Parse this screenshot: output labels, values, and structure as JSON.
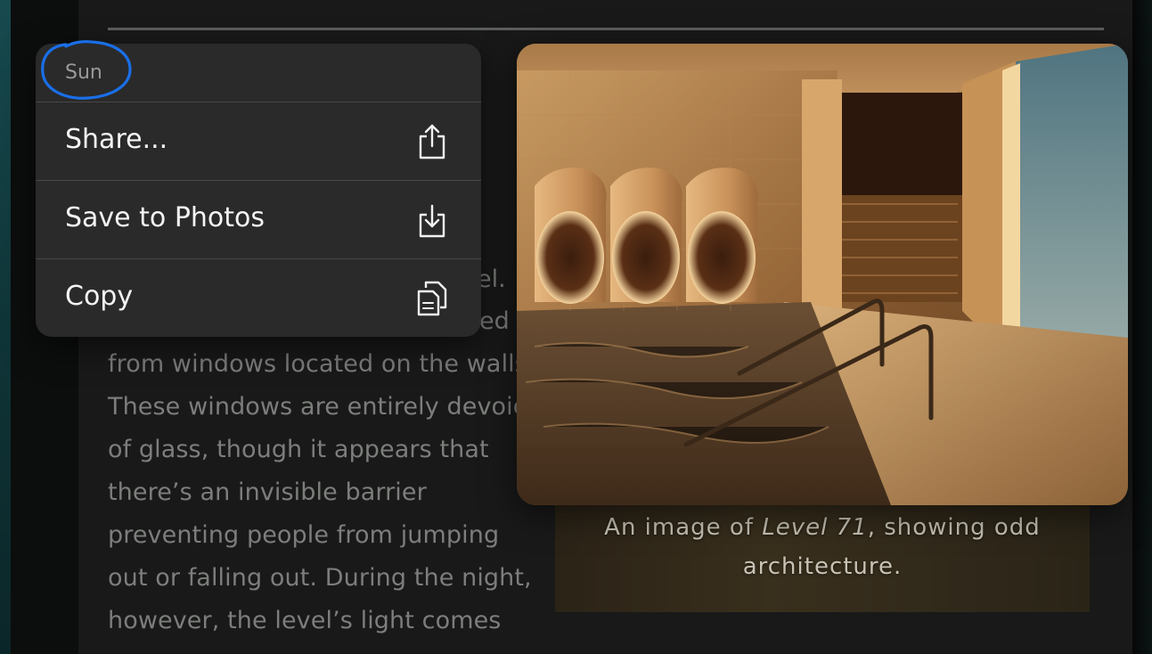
{
  "menu": {
    "header": "Sun",
    "items": [
      {
        "label": "Share...",
        "icon": "share-icon"
      },
      {
        "label": "Save to Photos",
        "icon": "save-to-photos-icon"
      },
      {
        "label": "Copy",
        "icon": "copy-icon"
      }
    ]
  },
  "article": {
    "fragments": [
      "el.",
      "ed"
    ],
    "lines": [
      "from windows located on the walls.",
      "These windows are entirely devoid",
      "of glass, though it appears that",
      "there’s an invisible barrier",
      "preventing people from jumping",
      "out or falling out. During the night,",
      "however, the level’s light comes"
    ]
  },
  "image": {
    "caption_prefix": "An image of ",
    "caption_italic": "Level 71",
    "caption_suffix": ", showing odd architecture."
  },
  "colors": {
    "annotation": "#1a6fe8",
    "menu_bg": "#2a2a2a"
  }
}
